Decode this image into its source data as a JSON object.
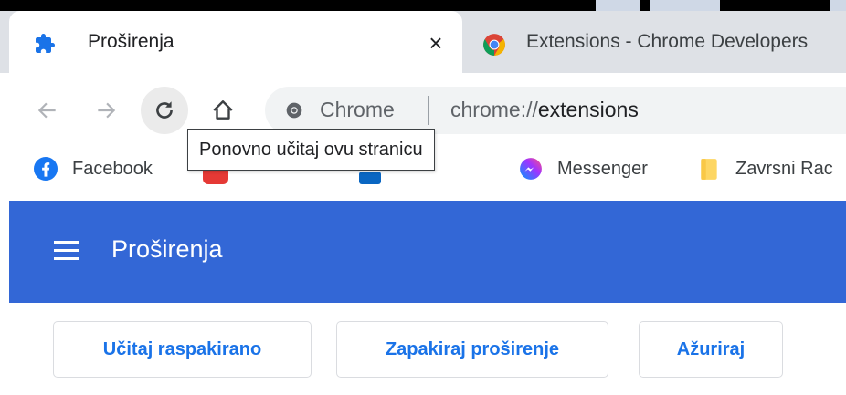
{
  "tabs": [
    {
      "title": "Proširenja",
      "icon": "puzzle-icon",
      "active": true,
      "close_glyph": "×"
    },
    {
      "title": "Extensions - Chrome Developers",
      "icon": "chrome-icon",
      "active": false
    }
  ],
  "toolbar": {
    "back_icon": "arrow-left-icon",
    "forward_icon": "arrow-right-icon",
    "reload_icon": "reload-icon",
    "home_icon": "home-icon"
  },
  "omnibox": {
    "chip": "Chrome",
    "url_scheme": "chrome://",
    "url_path": "extensions"
  },
  "tooltip": {
    "text": "Ponovno učitaj ovu stranicu"
  },
  "bookmarks": [
    {
      "label": "Facebook",
      "icon": "facebook-icon"
    },
    {
      "label": "",
      "icon": "youtube-icon"
    },
    {
      "label": "",
      "icon": "linkedin-icon"
    },
    {
      "label": "Messenger",
      "icon": "messenger-icon"
    },
    {
      "label": "Zavrsni Rac",
      "icon": "folder-icon"
    }
  ],
  "page": {
    "title": "Proširenja",
    "buttons": {
      "load_unpacked": "Učitaj raspakirano",
      "pack_extension": "Zapakiraj proširenje",
      "update": "Ažuriraj"
    }
  },
  "colors": {
    "header_blue": "#3367d6",
    "button_text": "#1a73e8",
    "tabstrip": "#dee1e6"
  }
}
